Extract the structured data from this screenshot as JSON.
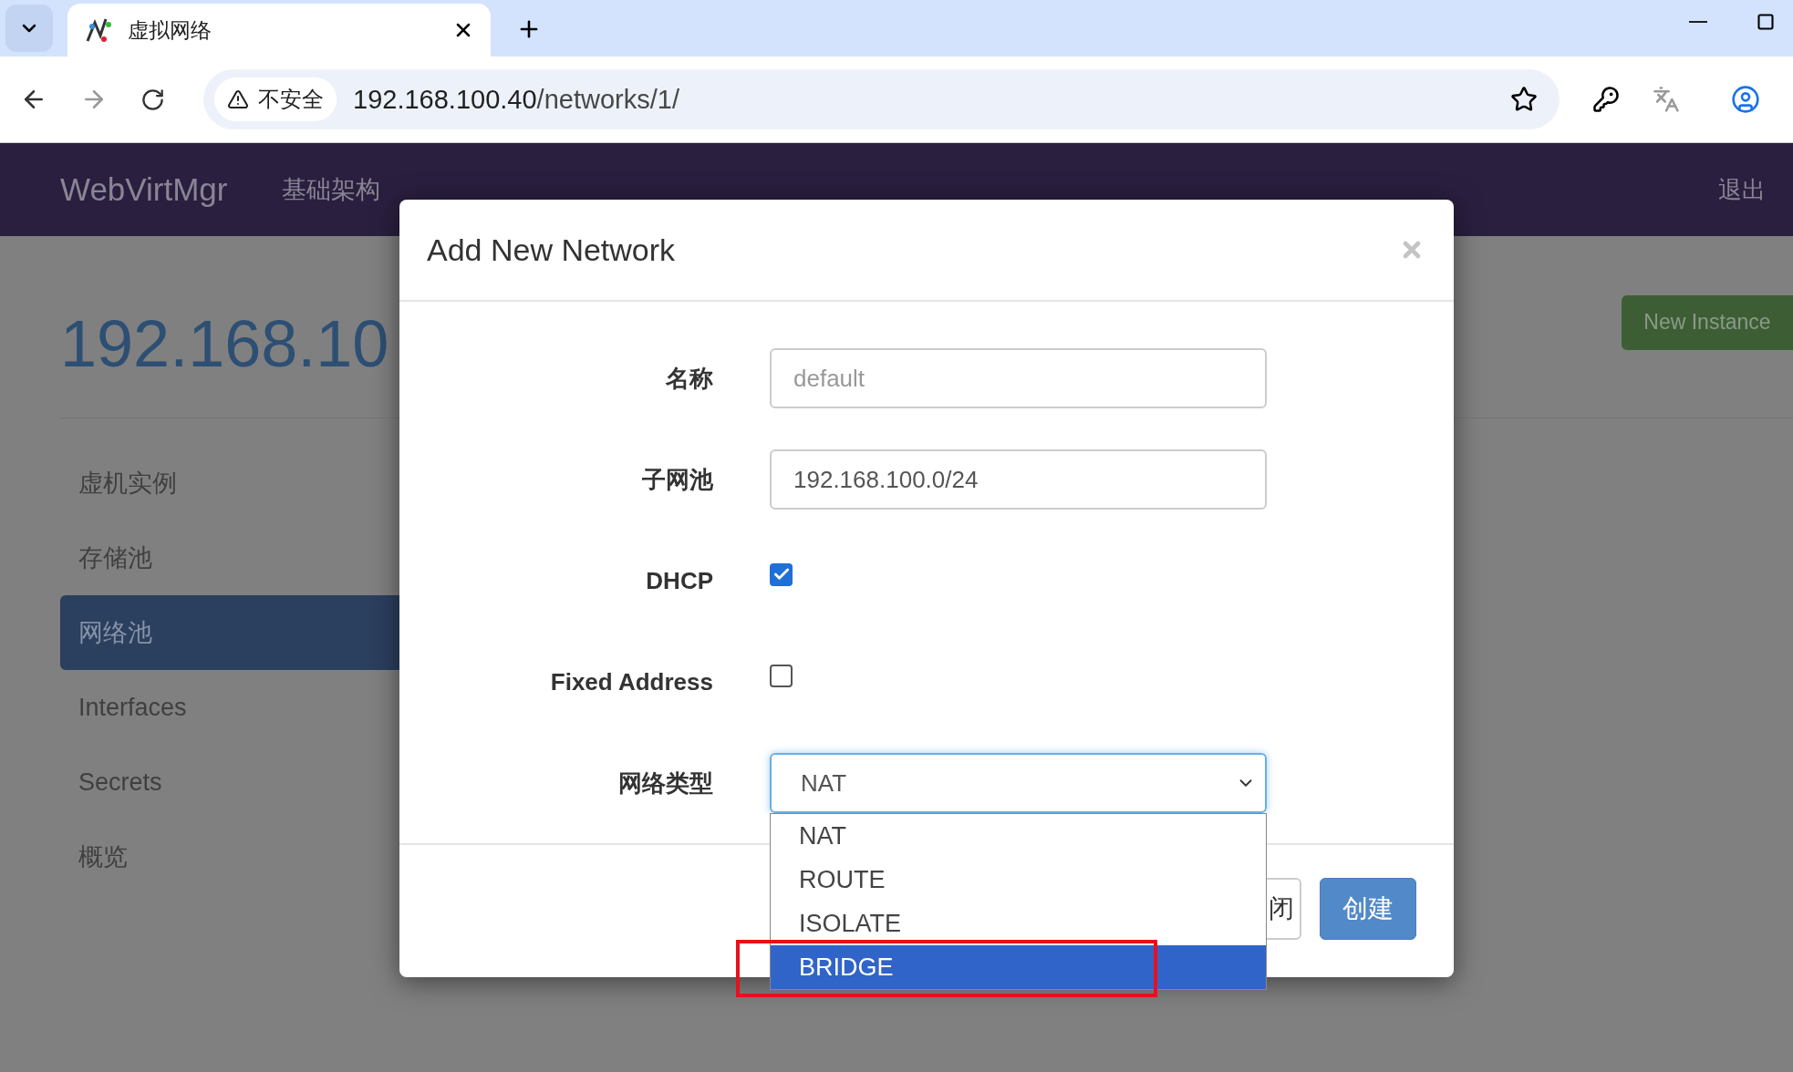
{
  "browser": {
    "tab_title": "虚拟网络",
    "security_label": "不安全",
    "url_host": "192.168.100.40",
    "url_path": "/networks/1/"
  },
  "navbar": {
    "brand": "WebVirtMgr",
    "links": [
      "基础架构"
    ],
    "logout": "退出"
  },
  "page": {
    "title": "192.168.10",
    "new_instance_button": "New Instance"
  },
  "sidebar": {
    "items": [
      {
        "label": "虚机实例",
        "selected": false
      },
      {
        "label": "存储池",
        "selected": false
      },
      {
        "label": "网络池",
        "selected": true
      },
      {
        "label": "Interfaces",
        "selected": false
      },
      {
        "label": "Secrets",
        "selected": false
      },
      {
        "label": "概览",
        "selected": false
      }
    ]
  },
  "modal": {
    "title": "Add New Network",
    "fields": [
      {
        "kind": "text",
        "label": "名称",
        "placeholder": "default"
      },
      {
        "kind": "text",
        "label": "子网池",
        "value": "192.168.100.0/24"
      },
      {
        "kind": "checkbox",
        "label": "DHCP",
        "checked": true
      },
      {
        "kind": "checkbox",
        "label": "Fixed Address",
        "checked": false
      },
      {
        "kind": "select",
        "label": "网络类型",
        "value": "NAT",
        "open": true,
        "options": [
          {
            "label": "NAT",
            "highlighted": false
          },
          {
            "label": "ROUTE",
            "highlighted": false
          },
          {
            "label": "ISOLATE",
            "highlighted": false
          },
          {
            "label": "BRIDGE",
            "highlighted": true
          }
        ]
      }
    ],
    "buttons": [
      {
        "kind": "secondary",
        "label": "闭"
      },
      {
        "kind": "primary",
        "label": "创建"
      }
    ]
  }
}
